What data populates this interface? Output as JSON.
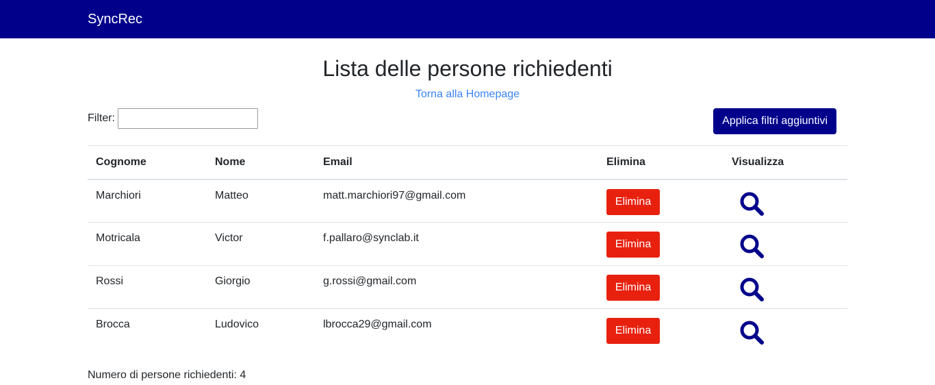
{
  "navbar": {
    "brand": "SyncRec"
  },
  "page": {
    "title": "Lista delle persone richiedenti",
    "home_link": "Torna alla Homepage"
  },
  "filter": {
    "label": "Filter:",
    "value": "",
    "placeholder": ""
  },
  "apply_button": "Applica filtri aggiuntivi",
  "table": {
    "headers": [
      "Cognome",
      "Nome",
      "Email",
      "Elimina",
      "Visualizza"
    ],
    "rows": [
      {
        "cognome": "Marchiori",
        "nome": "Matteo",
        "email": "matt.marchiori97@gmail.com",
        "delete_label": "Elimina"
      },
      {
        "cognome": "Motricala",
        "nome": "Victor",
        "email": "f.pallaro@synclab.it",
        "delete_label": "Elimina"
      },
      {
        "cognome": "Rossi",
        "nome": "Giorgio",
        "email": "g.rossi@gmail.com",
        "delete_label": "Elimina"
      },
      {
        "cognome": "Brocca",
        "nome": "Ludovico",
        "email": "lbrocca29@gmail.com",
        "delete_label": "Elimina"
      }
    ]
  },
  "count_text": "Numero di persone richiedenti: 4",
  "colors": {
    "navbar": "#00008b",
    "delete": "#e8210f",
    "link": "#3b82f6",
    "icon": "#00008b"
  },
  "icons": {
    "view": "search-icon"
  }
}
